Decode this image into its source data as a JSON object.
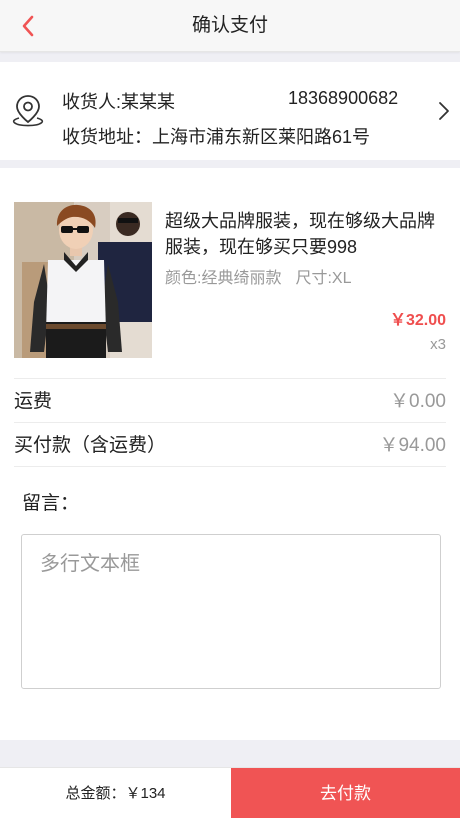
{
  "colors": {
    "accent": "#f05454",
    "price": "#ef4e4e",
    "muted": "#999999",
    "background": "#efeff4"
  },
  "header": {
    "title": "确认支付",
    "back_icon": "chevron-left-icon"
  },
  "address": {
    "icon": "location-pin-icon",
    "recipient": "收货人:某某某",
    "phone": "18368900682",
    "detail": "收货地址：上海市浦东新区莱阳路61号",
    "arrow_icon": "chevron-right-icon"
  },
  "product": {
    "title": "超级大品牌服装，现在够级大品牌服装，现在够买只要998",
    "color": "颜色:经典绮丽款",
    "size": "尺寸:XL",
    "price": "￥32.00",
    "quantity": "x3"
  },
  "fees": {
    "shipping_label": "运费",
    "shipping_value": "￥0.00",
    "actual_label": "买付款（含运费）",
    "actual_value": "￥94.00"
  },
  "message": {
    "label": "留言：",
    "placeholder": "多行文本框"
  },
  "footer": {
    "total": "总金额：￥134",
    "pay_label": "去付款"
  }
}
